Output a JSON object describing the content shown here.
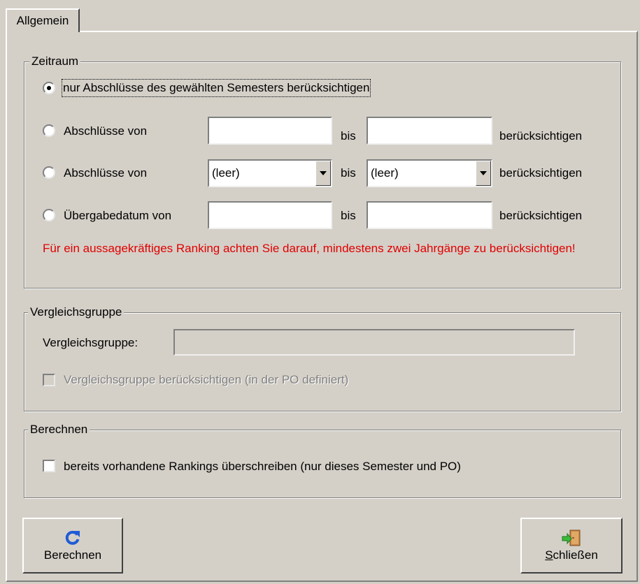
{
  "tabs": [
    {
      "label": "Allgemein",
      "active": true
    }
  ],
  "zeitraum": {
    "legend": "Zeitraum",
    "option_semester": "nur Abschlüsse des gewählten Semesters berücksichtigen",
    "option_abschluesse_text": {
      "label": "Abschlüsse von",
      "from_value": "",
      "bis": "bis",
      "to_value": "",
      "suffix": "berücksichtigen"
    },
    "option_abschluesse_select": {
      "label": "Abschlüsse von",
      "from_selected": "(leer)",
      "bis": "bis",
      "to_selected": "(leer)",
      "suffix": "berücksichtigen"
    },
    "option_uebergabe": {
      "label": "Übergabedatum von",
      "from_value": "",
      "bis": "bis",
      "to_value": "",
      "suffix": "berücksichtigen"
    },
    "warning": "Für ein aussagekräftiges Ranking achten Sie darauf, mindestens zwei Jahrgänge zu berücksichtigen!",
    "warning_color": "#e00000",
    "selected_option": "option_semester"
  },
  "vergleichsgruppe": {
    "legend": "Vergleichsgruppe",
    "field_label": "Vergleichsgruppe:",
    "field_value": "",
    "checkbox_label": "Vergleichsgruppe berücksichtigen (in der PO definiert)",
    "checkbox_checked": false,
    "checkbox_enabled": false
  },
  "berechnen_group": {
    "legend": "Berechnen",
    "checkbox_label": "bereits vorhandene Rankings überschreiben (nur dieses Semester und PO)",
    "checkbox_checked": false
  },
  "buttons": {
    "berechnen": {
      "label": "Berechnen",
      "icon": "refresh-icon",
      "icon_color": "#1f5bd6"
    },
    "schliessen": {
      "label_hotkey": "S",
      "label_rest": "chließen",
      "icon": "exit-door-icon"
    }
  }
}
